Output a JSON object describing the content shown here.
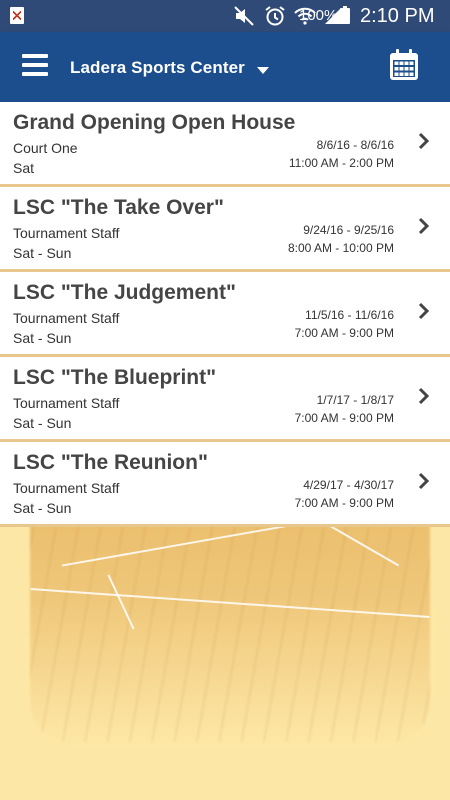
{
  "status_bar": {
    "battery_text": "100%",
    "time": "2:10 PM",
    "icons": [
      "notification-app-icon",
      "mute-icon",
      "alarm-icon",
      "wifi-icon",
      "signal-icon",
      "battery-icon"
    ]
  },
  "app_bar": {
    "center_name": "Ladera Sports Center",
    "menu_icon": "hamburger-menu-icon",
    "dropdown_icon": "caret-down-icon",
    "calendar_icon": "calendar-icon",
    "background_color": "#1c4d8c"
  },
  "events": [
    {
      "title": "Grand Opening Open House",
      "location": "Court One",
      "days": "Sat",
      "dates": "8/6/16 - 8/6/16",
      "times": "11:00 AM - 2:00 PM"
    },
    {
      "title": "LSC \"The Take Over\"",
      "location": "Tournament Staff",
      "days": "Sat - Sun",
      "dates": "9/24/16 - 9/25/16",
      "times": "8:00 AM - 10:00 PM"
    },
    {
      "title": "LSC \"The Judgement\"",
      "location": "Tournament Staff",
      "days": "Sat - Sun",
      "dates": "11/5/16 - 11/6/16",
      "times": "7:00 AM - 9:00 PM"
    },
    {
      "title": "LSC \"The Blueprint\"",
      "location": "Tournament Staff",
      "days": "Sat - Sun",
      "dates": "1/7/17 - 1/8/17",
      "times": "7:00 AM - 9:00 PM"
    },
    {
      "title": "LSC \"The Reunion\"",
      "location": "Tournament Staff",
      "days": "Sat - Sun",
      "dates": "4/29/17 - 4/30/17",
      "times": "7:00 AM - 9:00 PM"
    }
  ],
  "colors": {
    "status_bar": "#2f4a77",
    "app_bar": "#1c4d8c",
    "background": "#fde7a6",
    "row_separator": "#e7c78b",
    "title_text": "#454545"
  }
}
